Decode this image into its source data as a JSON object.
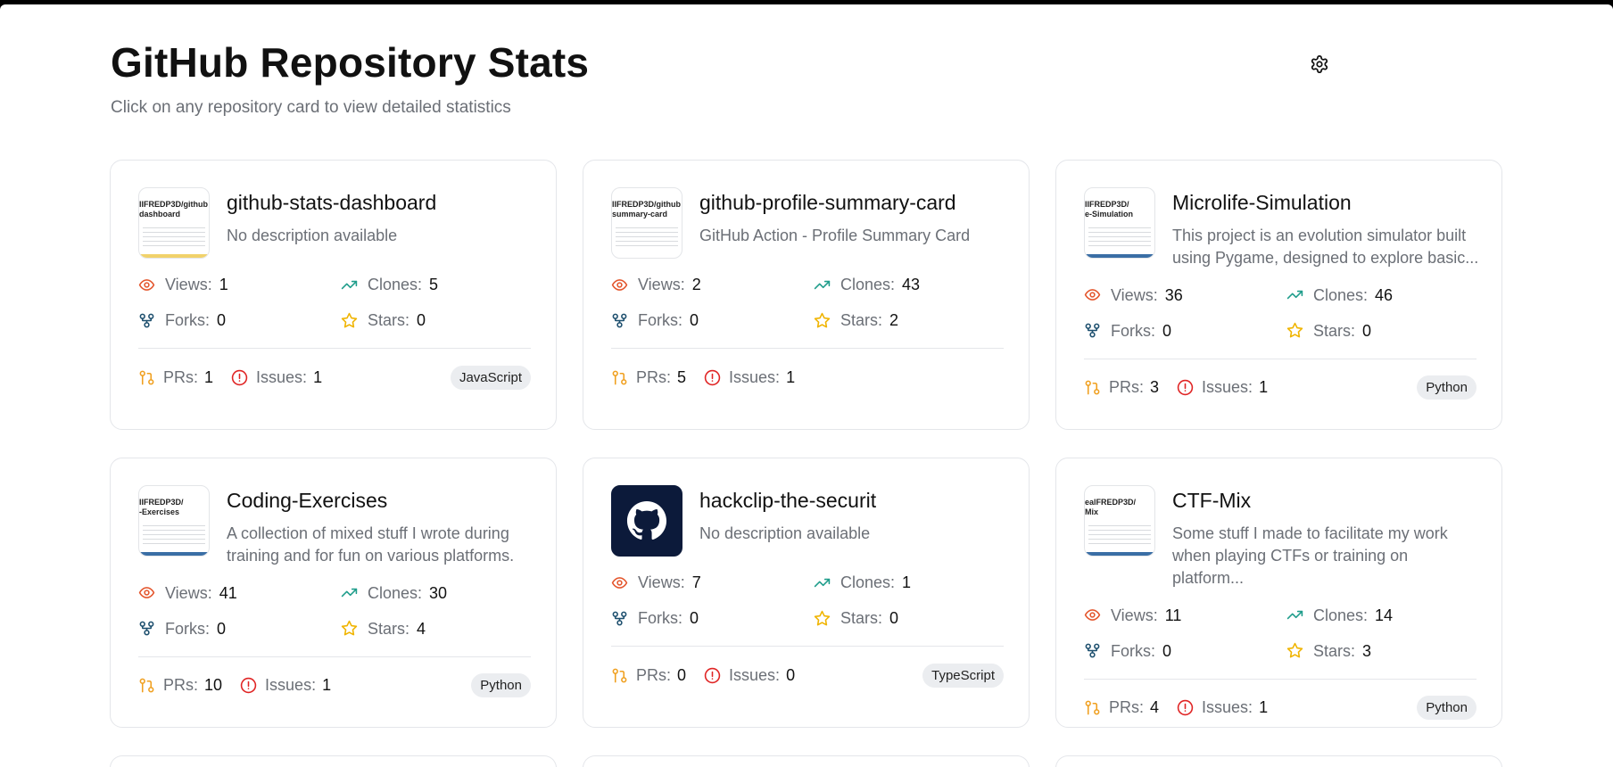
{
  "header": {
    "title": "GitHub Repository Stats",
    "subtitle": "Click on any repository card to view detailed statistics",
    "settings_icon": "gear-icon"
  },
  "labels": {
    "views": "Views:",
    "clones": "Clones:",
    "forks": "Forks:",
    "stars": "Stars:",
    "prs": "PRs:",
    "issues": "Issues:"
  },
  "colors": {
    "views": "#e4572e",
    "clones": "#1f9d8b",
    "forks": "#1d4f6e",
    "stars": "#f0b400",
    "prs": "#f0a020",
    "issues": "#e02424"
  },
  "repos": [
    {
      "name": "github-stats-dashboard",
      "description": "No description available",
      "thumb": "IIFREDP3D/github\ndashboard",
      "bar_color": "#f1d26b",
      "views": "1",
      "clones": "5",
      "forks": "0",
      "stars": "0",
      "prs": "1",
      "issues": "1",
      "language": "JavaScript"
    },
    {
      "name": "github-profile-summary-card",
      "description": "GitHub Action - Profile Summary Card",
      "thumb": "IIFREDP3D/github\nsummary-card",
      "bar_color": "",
      "views": "2",
      "clones": "43",
      "forks": "0",
      "stars": "2",
      "prs": "5",
      "issues": "1",
      "language": ""
    },
    {
      "name": "Microlife-Simulation",
      "description": "This project is an evolution simulator built using Pygame, designed to explore basic...",
      "thumb": "IIFREDP3D/\ne-Simulation",
      "bar_color": "#3a6ea5",
      "views": "36",
      "clones": "46",
      "forks": "0",
      "stars": "0",
      "prs": "3",
      "issues": "1",
      "language": "Python"
    },
    {
      "name": "Coding-Exercises",
      "description": "A collection of mixed stuff I wrote during training and for fun on various platforms.",
      "thumb": "IIFREDP3D/\n-Exercises",
      "bar_color": "#3a6ea5",
      "views": "41",
      "clones": "30",
      "forks": "0",
      "stars": "4",
      "prs": "10",
      "issues": "1",
      "language": "Python"
    },
    {
      "name": "hackclip-the-securit",
      "description": "No description available",
      "thumb": "",
      "bar_color": "",
      "views": "7",
      "clones": "1",
      "forks": "0",
      "stars": "0",
      "prs": "0",
      "issues": "0",
      "language": "TypeScript"
    },
    {
      "name": "CTF-Mix",
      "description": "Some stuff I made to facilitate my work when playing CTFs or training on platform...",
      "thumb": "ealFREDP3D/\nMix",
      "bar_color": "#3a6ea5",
      "views": "11",
      "clones": "14",
      "forks": "0",
      "stars": "3",
      "prs": "4",
      "issues": "1",
      "language": "Python"
    }
  ]
}
